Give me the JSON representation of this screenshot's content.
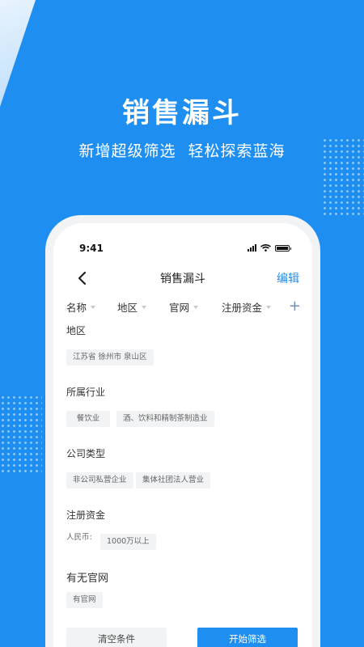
{
  "hero": {
    "title": "销售漏斗",
    "subtitle": "新增超级筛选  轻松探索蓝海"
  },
  "status_bar": {
    "time": "9:41"
  },
  "nav": {
    "title": "销售漏斗",
    "edit_label": "编辑"
  },
  "filter_bar": {
    "items": [
      "名称",
      "地区",
      "官网",
      "注册资金"
    ],
    "add_symbol": "+"
  },
  "sections": {
    "region": {
      "label": "地区",
      "tags": [
        "江苏省 徐州市 泉山区"
      ]
    },
    "industry": {
      "label": "所属行业",
      "tags": [
        "餐饮业",
        "酒、饮料和精制茶制造业"
      ]
    },
    "company_type": {
      "label": "公司类型",
      "tags": [
        "非公司私营企业",
        "集体社团法人营业"
      ]
    },
    "capital": {
      "label": "注册资金",
      "currency_label": "人民币:",
      "tags": [
        "1000万以上"
      ]
    },
    "website": {
      "label": "有无官网",
      "tags": [
        "有官网"
      ]
    }
  },
  "actions": {
    "clear_label": "清空条件",
    "start_label": "开始筛选"
  },
  "colors": {
    "brand_blue": "#1f8ef1",
    "tag_bg": "#f2f3f5"
  }
}
